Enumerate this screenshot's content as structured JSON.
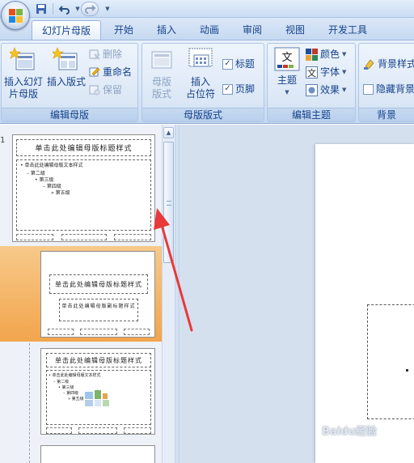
{
  "tabs": [
    {
      "label": "幻灯片母版",
      "active": true
    },
    {
      "label": "开始"
    },
    {
      "label": "插入"
    },
    {
      "label": "动画"
    },
    {
      "label": "审阅"
    },
    {
      "label": "视图"
    },
    {
      "label": "开发工具"
    }
  ],
  "groups": {
    "edit_master": {
      "label": "编辑母版",
      "insert_master": "插入幻灯\n片母版",
      "insert_layout": "插入版式",
      "delete": "删除",
      "rename": "重命名",
      "preserve": "保留"
    },
    "master_layout": {
      "label": "母版版式",
      "master_layout_btn": "母版\n版式",
      "insert_placeholder": "插入\n占位符",
      "title_check": "标题",
      "footer_check": "页脚"
    },
    "edit_theme": {
      "label": "编辑主题",
      "theme": "主题",
      "colors": "颜色",
      "fonts": "字体",
      "effects": "效果"
    },
    "background": {
      "label": "背景",
      "bg_styles": "背景样式",
      "hide_bg": "隐藏背景"
    }
  },
  "thumbnails": {
    "slide_number": "1",
    "master": {
      "title": "单击此处编辑母版标题样式",
      "levels": [
        "• 单击此处编辑母版文本样式",
        "– 第二级",
        "• 第三级",
        "– 第四级",
        "» 第五级"
      ]
    },
    "layout1": {
      "title": "单击此处编辑母版标题样式",
      "subtitle": "单击此处编辑母版副标题样式"
    },
    "layout2": {
      "title": "单击此处编辑母版标题样式",
      "levels": [
        "• 单击此处编辑母版文本样式",
        "– 第二级",
        "• 第三级",
        "– 第四级",
        "» 第五级"
      ]
    }
  },
  "colors": {
    "accent_orange": "#f2a54d",
    "ribbon_text": "#15428b",
    "arrow": "#e8393a"
  },
  "icons": {
    "office_button": "office-logo-icon",
    "save": "save-icon",
    "undo": "undo-icon",
    "redo": "redo-icon"
  },
  "watermark": "Baidu经验"
}
